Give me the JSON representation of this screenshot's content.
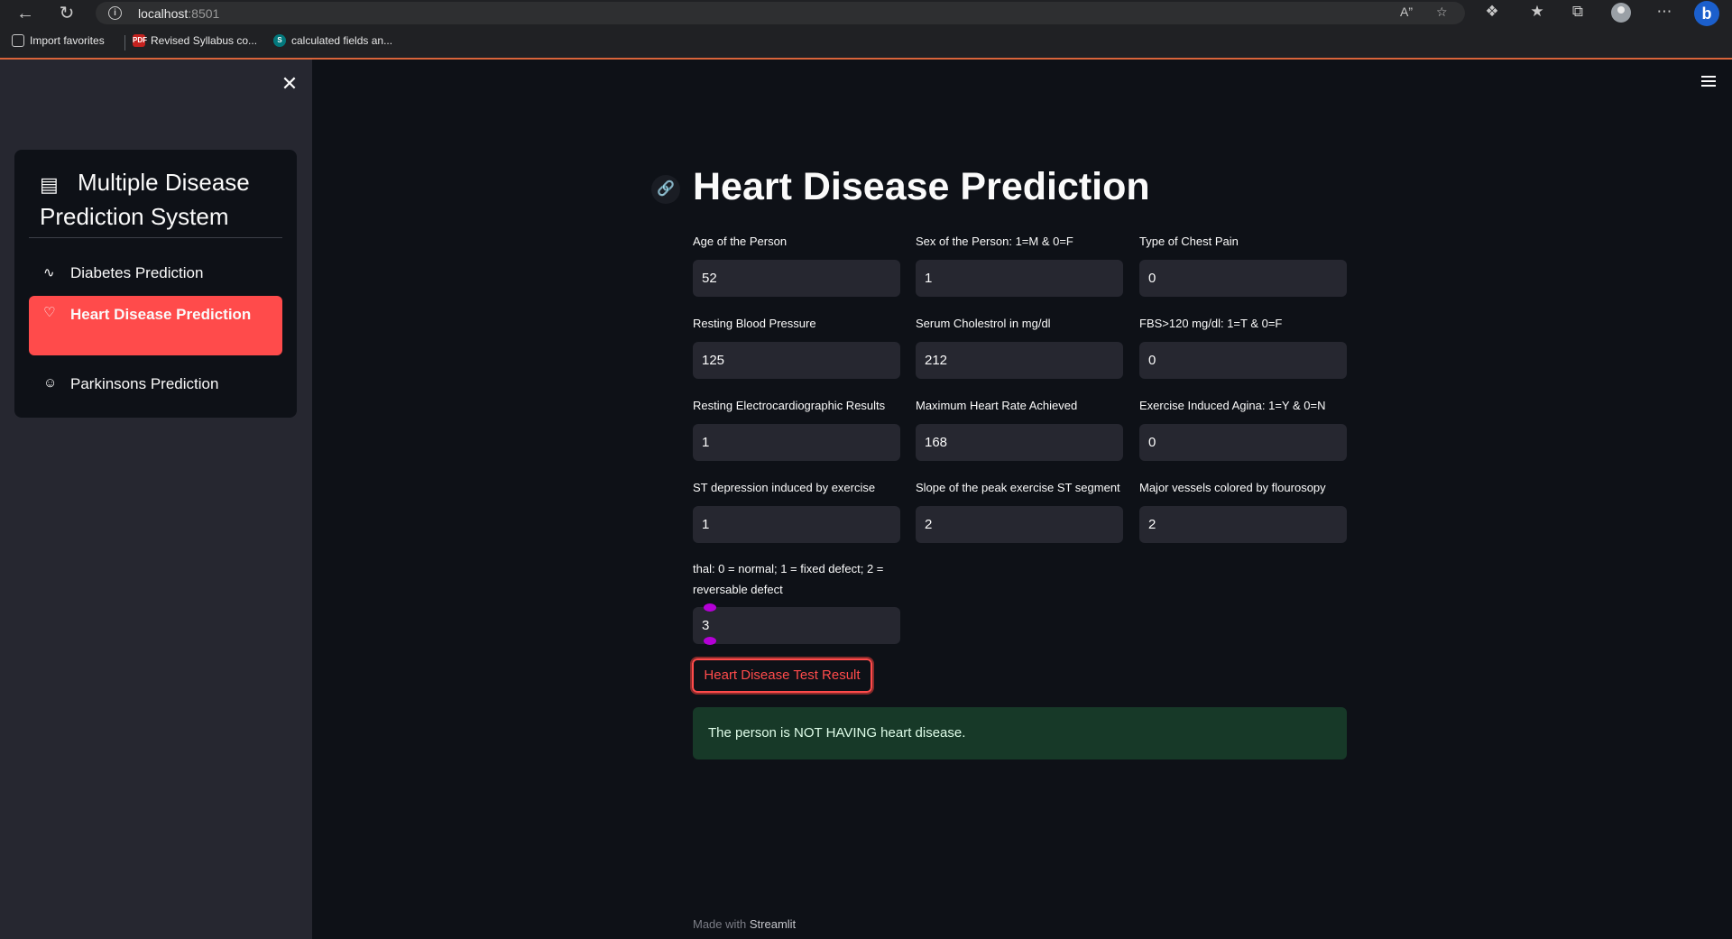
{
  "browser": {
    "url_host": "localhost",
    "url_port": ":8501",
    "bookmarks": [
      {
        "label": "Import favorites",
        "icon": "import-icon"
      },
      {
        "label": "Revised Syllabus co...",
        "icon": "pdf-icon"
      },
      {
        "label": "calculated fields an...",
        "icon": "sharepoint-icon"
      }
    ]
  },
  "sidebar": {
    "title": "Multiple Disease Prediction System",
    "items": [
      {
        "label": "Diabetes Prediction",
        "icon": "activity-icon",
        "active": false
      },
      {
        "label": "Heart Disease Prediction",
        "icon": "heart-icon",
        "active": true
      },
      {
        "label": "Parkinsons Prediction",
        "icon": "person-icon",
        "active": false
      }
    ]
  },
  "main": {
    "title": "Heart Disease Prediction",
    "fields": [
      {
        "label": "Age of the Person",
        "value": "52"
      },
      {
        "label": "Sex of the Person: 1=M & 0=F",
        "value": "1"
      },
      {
        "label": "Type of Chest Pain",
        "value": "0"
      },
      {
        "label": "Resting Blood Pressure",
        "value": "125"
      },
      {
        "label": "Serum Cholestrol in mg/dl",
        "value": "212"
      },
      {
        "label": "FBS>120 mg/dl: 1=T & 0=F",
        "value": "0"
      },
      {
        "label": "Resting Electrocardiographic Results",
        "value": "1"
      },
      {
        "label": "Maximum Heart Rate Achieved",
        "value": "168"
      },
      {
        "label": "Exercise Induced Agina: 1=Y & 0=N",
        "value": "0"
      },
      {
        "label": "ST depression induced by exercise",
        "value": "1"
      },
      {
        "label": "Slope of the peak exercise ST segment",
        "value": "2"
      },
      {
        "label": "Major vessels colored by flourosopy",
        "value": "2"
      },
      {
        "label": "thal: 0 = normal; 1 = fixed defect; 2 = reversable defect",
        "value": "3"
      }
    ],
    "button_label": "Heart Disease Test Result",
    "result_text": "The person is NOT HAVING heart disease.",
    "footer_prefix": "Made with",
    "footer_brand": "Streamlit"
  },
  "colors": {
    "accent": "#ff4b4b",
    "background": "#0e1117",
    "sidebar": "#262730",
    "success_bg": "#173928"
  }
}
